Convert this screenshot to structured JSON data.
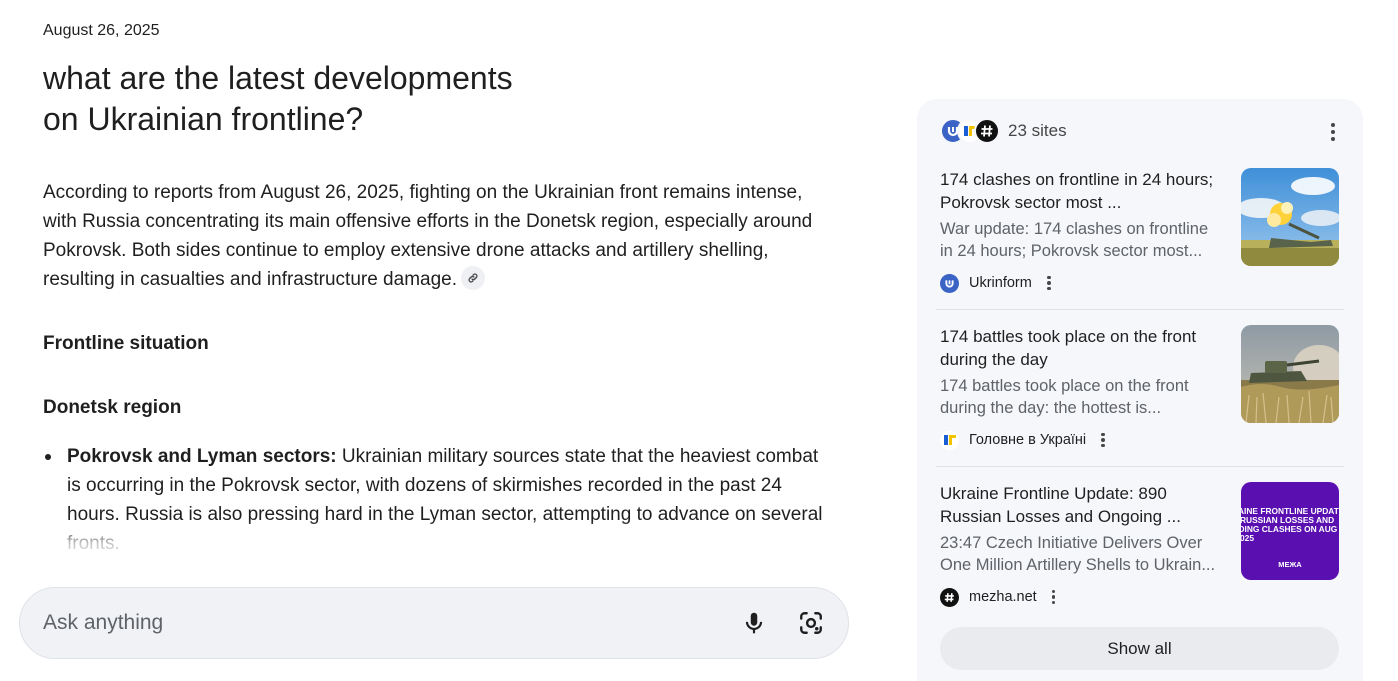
{
  "answer": {
    "date": "August 26, 2025",
    "query_line1": "what are the latest developments",
    "query_line2": "on Ukrainian frontline?",
    "summary": "According to reports from August 26, 2025, fighting on the Ukrainian front remains intense, with Russia concentrating its main offensive efforts in the Donetsk region, especially around Pokrovsk. Both sides continue to employ extensive drone attacks and artillery shelling, resulting in casualties and infrastructure damage.",
    "heading_frontline": "Frontline situation",
    "heading_donetsk": "Donetsk region",
    "bullets": [
      {
        "strong": "Pokrovsk and Lyman sectors:",
        "text": " Ukrainian military sources state that the heaviest combat is occurring in the Pokrovsk sector, with dozens of skirmishes recorded in the past 24 hours. Russia is also pressing hard in the Lyman sector, attempting to advance on several fronts."
      }
    ]
  },
  "ask_bar": {
    "placeholder": "Ask anything",
    "mic_icon": "mic-icon",
    "lens_icon": "lens-icon"
  },
  "sources": {
    "count_label": "23 sites",
    "cards": [
      {
        "title": "174 clashes on frontline in 24 hours; Pokrovsk sector most ...",
        "snippet_line1": "War update: 174 clashes on frontline",
        "snippet_line2": "in 24 hours; Pokrovsk sector most...",
        "source": "Ukrinform",
        "favicon": "ukrinform-favicon"
      },
      {
        "title": "174 battles took place on the front during the day",
        "snippet_line1": "174 battles took place on the front",
        "snippet_line2": "during the day: the hottest is...",
        "source": "Головне в Україні",
        "favicon": "golovne-favicon"
      },
      {
        "title": "Ukraine Frontline Update: 890 Russian Losses and Ongoing ...",
        "snippet_line1": "23:47 Czech Initiative Delivers Over",
        "snippet_line2": "One Million Artillery Shells to Ukrain...",
        "source": "mezha.net",
        "favicon": "mezha-favicon",
        "thumb_text": [
          "AINE FRONTLINE UPDAT",
          "RUSSIAN LOSSES AND",
          "OING CLASHES ON AUG",
          "025"
        ],
        "thumb_logo": "MEЖA"
      }
    ],
    "show_all_label": "Show all"
  },
  "colors": {
    "panel_bg": "#f5f7fa",
    "ask_bar_bg": "#f0f2f6",
    "ukrinform_blue": "#3a63c5",
    "mezha_purple": "#5a0fb0"
  }
}
